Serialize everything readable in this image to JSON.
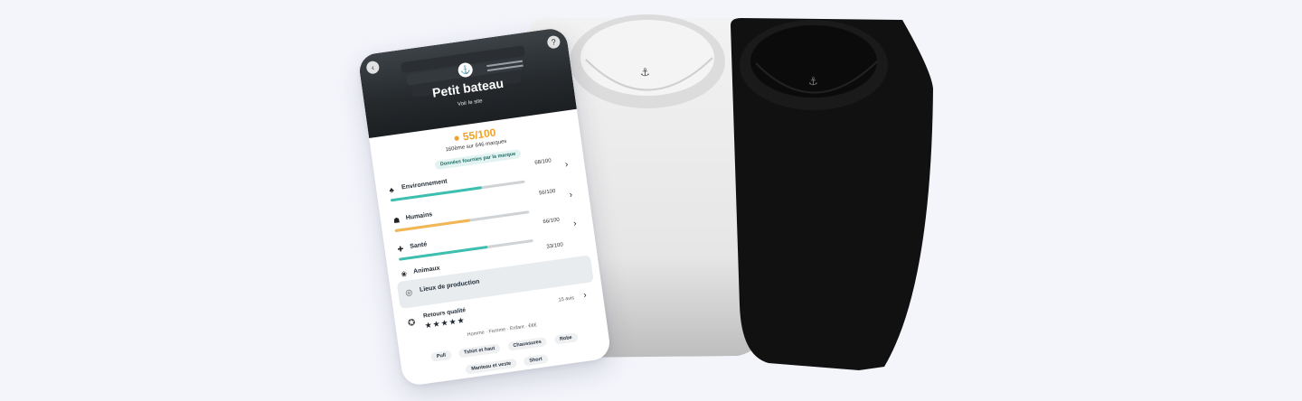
{
  "brand": {
    "name": "Petit bateau",
    "link": "Voir le site"
  },
  "score": {
    "value": "55/100",
    "rank": "160ème sur 646 marques",
    "data_source": "Données fournies par la marque"
  },
  "categories": [
    {
      "label": "Environnement",
      "score": "68/100",
      "fill": 0.68,
      "color": "#3bbfae",
      "icon": "leaf-icon"
    },
    {
      "label": "Humains",
      "score": "56/100",
      "fill": 0.56,
      "color": "#f2b653",
      "icon": "people-icon"
    },
    {
      "label": "Santé",
      "score": "66/100",
      "fill": 0.66,
      "color": "#3bbfae",
      "icon": "health-icon"
    },
    {
      "label": "Animaux",
      "score": "33/100",
      "fill": 0.33,
      "color": "#ee7a5b",
      "icon": "paw-icon"
    }
  ],
  "production": {
    "label": "Lieux de production"
  },
  "reviews": {
    "label": "Retours qualité",
    "stars": "★★★★★",
    "count": "15 avis"
  },
  "meta": "Homme · Femme · Enfant · €€€",
  "tags": [
    "Pull",
    "Tshirt et haut",
    "Chaussures",
    "Robe",
    "Manteau et veste",
    "Short"
  ]
}
